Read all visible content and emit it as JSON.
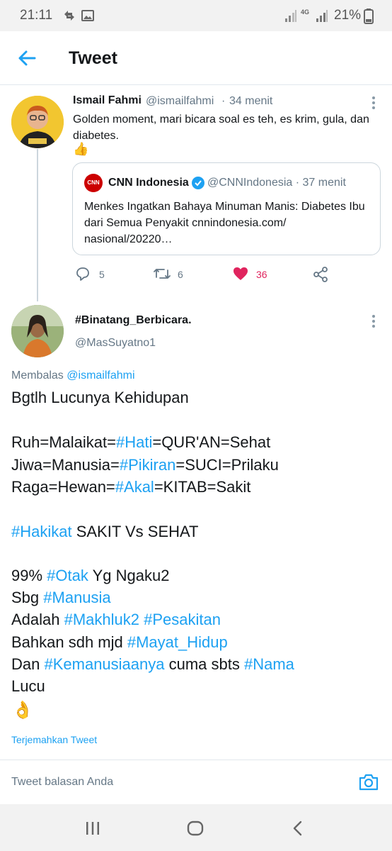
{
  "status_bar": {
    "time": "21:11",
    "network": "4G",
    "battery": "21%"
  },
  "header": {
    "title": "Tweet"
  },
  "tweet": {
    "author_name": "Ismail Fahmi",
    "author_handle": "@ismailfahmi",
    "separator": "·",
    "time": "34 menit",
    "text": "Golden moment, mari bicara soal es teh, es krim, gula, dan diabetes.",
    "emoji": "👍",
    "quote": {
      "logo_text": "CNN",
      "name": "CNN Indonesia",
      "handle": "@CNNIndonesia · 37 menit",
      "text": "Menkes Ingatkan Bahaya Minuman Manis: Diabetes Ibu dari Semua Penyakit cnnindonesia.com/ nasional/20220…"
    },
    "actions": {
      "replies": "5",
      "retweets": "6",
      "likes": "36"
    }
  },
  "reply": {
    "author_name": "#Binatang_Berbicara.",
    "author_handle": "@MasSuyatno1",
    "replying_prefix": "Membalas",
    "replying_to": "@ismailfahmi",
    "lines": [
      [
        {
          "t": "Bgtlh Lucunya Kehidupan"
        }
      ],
      [
        {
          "t": "Ruh=Malaikat="
        },
        {
          "t": "#Hati",
          "tag": true
        },
        {
          "t": "=QUR'AN=Sehat"
        }
      ],
      [
        {
          "t": "Jiwa=Manusia="
        },
        {
          "t": "#Pikiran",
          "tag": true
        },
        {
          "t": "=SUCI=Prilaku"
        }
      ],
      [
        {
          "t": "Raga=Hewan="
        },
        {
          "t": "#Akal",
          "tag": true
        },
        {
          "t": "=KITAB=Sakit"
        }
      ],
      [
        {
          "t": "#Hakikat",
          "tag": true
        },
        {
          "t": " SAKIT Vs SEHAT"
        }
      ],
      [
        {
          "t": "99% "
        },
        {
          "t": "#Otak",
          "tag": true
        },
        {
          "t": " Yg Ngaku2"
        }
      ],
      [
        {
          "t": "Sbg "
        },
        {
          "t": "#Manusia",
          "tag": true
        }
      ],
      [
        {
          "t": "Adalah "
        },
        {
          "t": "#Makhluk2",
          "tag": true
        },
        {
          "t": " "
        },
        {
          "t": "#Pesakitan",
          "tag": true
        }
      ],
      [
        {
          "t": "Bahkan sdh mjd "
        },
        {
          "t": "#Mayat_Hidup",
          "tag": true
        }
      ],
      [
        {
          "t": "Dan "
        },
        {
          "t": "#Kemanusiaanya",
          "tag": true
        },
        {
          "t": " cuma sbts "
        },
        {
          "t": "#Nama",
          "tag": true
        }
      ],
      [
        {
          "t": "Lucu"
        }
      ]
    ],
    "emoji": "👌",
    "translate_label": "Terjemahkan Tweet"
  },
  "composer": {
    "placeholder": "Tweet balasan Anda"
  },
  "icons": {
    "back": "arrow-left-icon",
    "more": "more-vertical-icon",
    "reply": "comment-icon",
    "retweet": "retweet-icon",
    "like": "heart-filled-icon",
    "share": "share-icon",
    "camera": "camera-icon",
    "verified": "verified-badge-icon"
  },
  "colors": {
    "accent": "#1da1f2",
    "like": "#e0245e",
    "muted": "#657786",
    "cnn_red": "#cc0000"
  }
}
